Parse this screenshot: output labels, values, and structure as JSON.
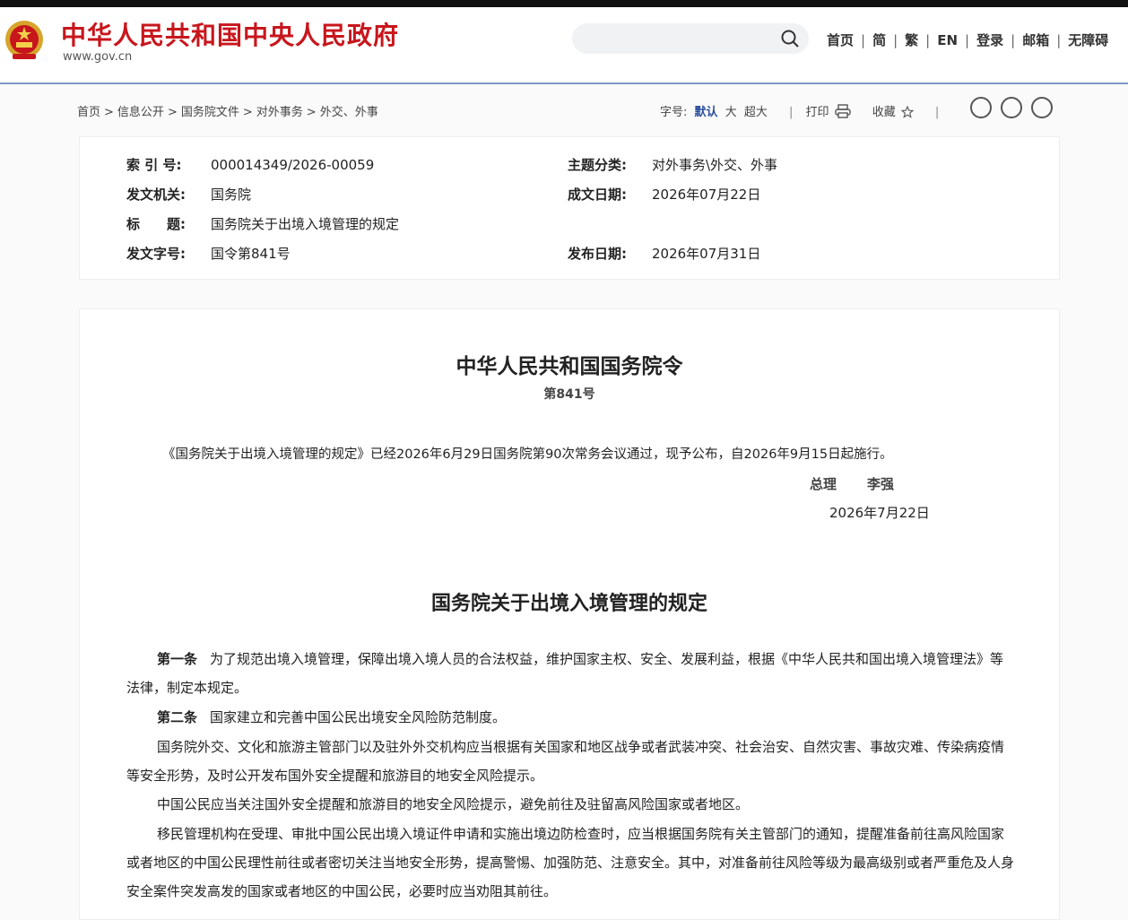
{
  "header": {
    "site_title": "中华人民共和国中央人民政府",
    "site_url": "www.gov.cn",
    "search_placeholder": "",
    "nav": [
      "首页",
      "简",
      "繁",
      "EN",
      "登录",
      "邮箱",
      "无障碍"
    ]
  },
  "breadcrumb": [
    "首页",
    "信息公开",
    "国务院文件",
    "对外事务",
    "外交、外事"
  ],
  "tools": {
    "font_label": "字号:",
    "font_options": [
      "默认",
      "大",
      "超大"
    ],
    "print": "打印",
    "favorite": "收藏"
  },
  "meta": {
    "index_label": "索 引 号:",
    "index_value": "000014349/2026-00059",
    "subject_label": "主题分类:",
    "subject_value": "对外事务\\外交、外事",
    "issuer_label": "发文机关:",
    "issuer_value": "国务院",
    "written_label": "成文日期:",
    "written_value": "2026年07月22日",
    "title_label": "标　　题:",
    "title_value": "国务院关于出境入境管理的规定",
    "docno_label": "发文字号:",
    "docno_value": "国令第841号",
    "published_label": "发布日期:",
    "published_value": "2026年07月31日"
  },
  "document": {
    "title": "中华人民共和国国务院令",
    "number": "第841号",
    "decree": "《国务院关于出境入境管理的规定》已经2026年6月29日国务院第90次常务会议通过，现予公布，自2026年9月15日起施行。",
    "sign_title": "总理",
    "sign_name": "李强",
    "sign_date": "2026年7月22日",
    "subtitle": "国务院关于出境入境管理的规定",
    "p1_art": "第一条",
    "p1_text": "为了规范出境入境管理，保障出境入境人员的合法权益，维护国家主权、安全、发展利益，根据《中华人民共和国出境入境管理法》等法律，制定本规定。",
    "p2_art": "第二条",
    "p2_text": "国家建立和完善中国公民出境安全风险防范制度。",
    "p3_text": "国务院外交、文化和旅游主管部门以及驻外外交机构应当根据有关国家和地区战争或者武装冲突、社会治安、自然灾害、事故灾难、传染病疫情等安全形势，及时公开发布国外安全提醒和旅游目的地安全风险提示。",
    "p4_text": "中国公民应当关注国外安全提醒和旅游目的地安全风险提示，避免前往及驻留高风险国家或者地区。",
    "p5_text": "移民管理机构在受理、审批中国公民出境入境证件申请和实施出境边防检查时，应当根据国务院有关主管部门的通知，提醒准备前往高风险国家或者地区的中国公民理性前往或者密切关注当地安全形势，提高警惕、加强防范、注意安全。其中，对准备前往风险等级为最高级别或者严重危及人身安全案件突发高发的国家或者地区的中国公民，必要时应当劝阻其前往。"
  }
}
